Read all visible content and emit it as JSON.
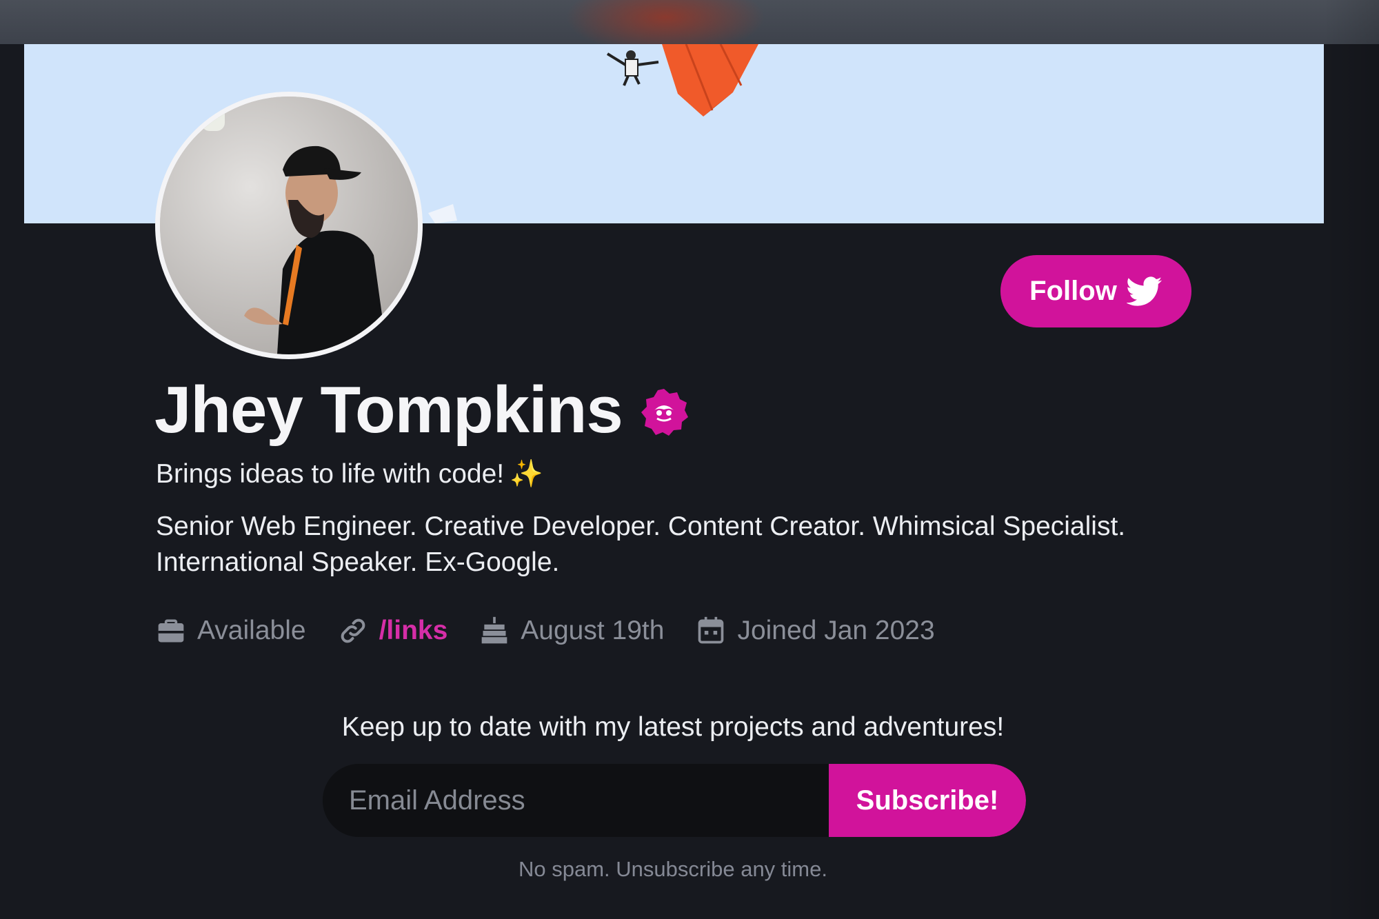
{
  "profile": {
    "name": "Jhey Tompkins",
    "tagline": "Brings ideas to life with code!",
    "tagline_emoji": "✨",
    "bio": "Senior Web Engineer. Creative Developer. Content Creator. Whimsical Specialist. International Speaker. Ex-Google.",
    "follow_label": "Follow"
  },
  "meta": {
    "status": "Available",
    "link": "/links",
    "birthday": "August 19th",
    "joined": "Joined Jan 2023"
  },
  "newsletter": {
    "heading": "Keep up to date with my latest projects and adventures!",
    "email_placeholder": "Email Address",
    "subscribe_label": "Subscribe!",
    "fineprint": "No spam. Unsubscribe any time."
  },
  "colors": {
    "accent": "#d1139b",
    "background": "#17191f",
    "banner": "#d0e4fb"
  },
  "icons": {
    "follow": "twitter-bird-icon",
    "verified": "verified-badge-icon",
    "status": "briefcase-icon",
    "link": "link-icon",
    "birthday": "cake-icon",
    "joined": "calendar-icon"
  }
}
